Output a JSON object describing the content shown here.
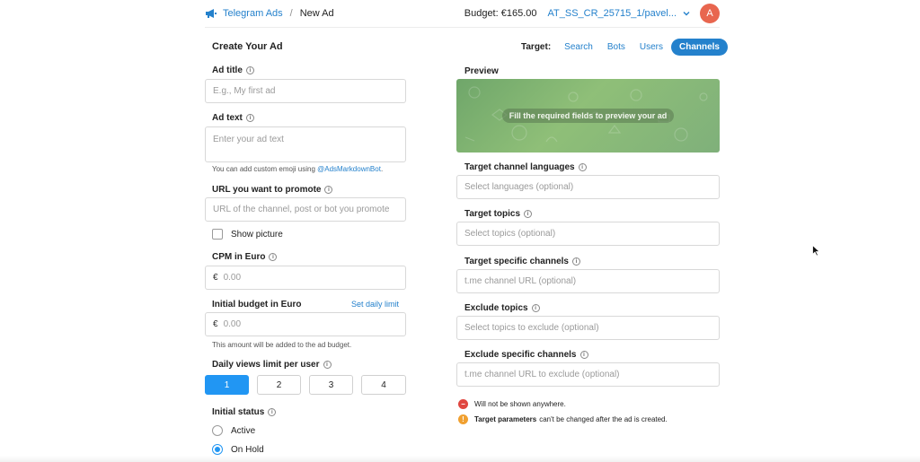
{
  "header": {
    "app_name": "Telegram Ads",
    "separator": "/",
    "page_name": "New Ad",
    "budget": "Budget: €165.00",
    "account": "AT_SS_CR_25715_1/pavel...",
    "avatar_letter": "A"
  },
  "form": {
    "title": "Create Your Ad",
    "target_label": "Target:",
    "target_tabs": [
      "Search",
      "Bots",
      "Users",
      "Channels"
    ],
    "active_tab": "Channels",
    "ad_title": {
      "label": "Ad title",
      "placeholder": "E.g., My first ad"
    },
    "ad_text": {
      "label": "Ad text",
      "placeholder": "Enter your ad text",
      "hint_prefix": "You can add custom emoji using ",
      "hint_link": "@AdsMarkdownBot",
      "hint_suffix": "."
    },
    "url": {
      "label": "URL you want to promote",
      "placeholder": "URL of the channel, post or bot you promote"
    },
    "show_picture": {
      "label": "Show picture",
      "checked": false
    },
    "cpm": {
      "label": "CPM in Euro",
      "currency": "€",
      "placeholder": "0.00"
    },
    "budget": {
      "label": "Initial budget in Euro",
      "link": "Set daily limit",
      "currency": "€",
      "placeholder": "0.00",
      "hint": "This amount will be added to the ad budget."
    },
    "daily_views": {
      "label": "Daily views limit per user",
      "options": [
        "1",
        "2",
        "3",
        "4"
      ],
      "selected": "1"
    },
    "status": {
      "label": "Initial status",
      "options": [
        "Active",
        "On Hold"
      ],
      "selected": "On Hold"
    }
  },
  "right": {
    "preview_label": "Preview",
    "preview_message": "Fill the required fields to preview your ad",
    "languages": {
      "label": "Target channel languages",
      "placeholder": "Select languages (optional)"
    },
    "topics": {
      "label": "Target topics",
      "placeholder": "Select topics (optional)"
    },
    "channels": {
      "label": "Target specific channels",
      "placeholder": "t.me channel URL (optional)"
    },
    "exclude_topics": {
      "label": "Exclude topics",
      "placeholder": "Select topics to exclude (optional)"
    },
    "exclude_channels": {
      "label": "Exclude specific channels",
      "placeholder": "t.me channel URL to exclude (optional)"
    },
    "note_warning": "Will not be shown anywhere.",
    "note_info_bold": "Target parameters",
    "note_info_rest": "can't be changed after the ad is created."
  },
  "colors": {
    "accent": "#2481cc",
    "active_button": "#2196f3",
    "avatar": "#e8664f",
    "error": "#e0463f",
    "warning": "#f0a030"
  }
}
